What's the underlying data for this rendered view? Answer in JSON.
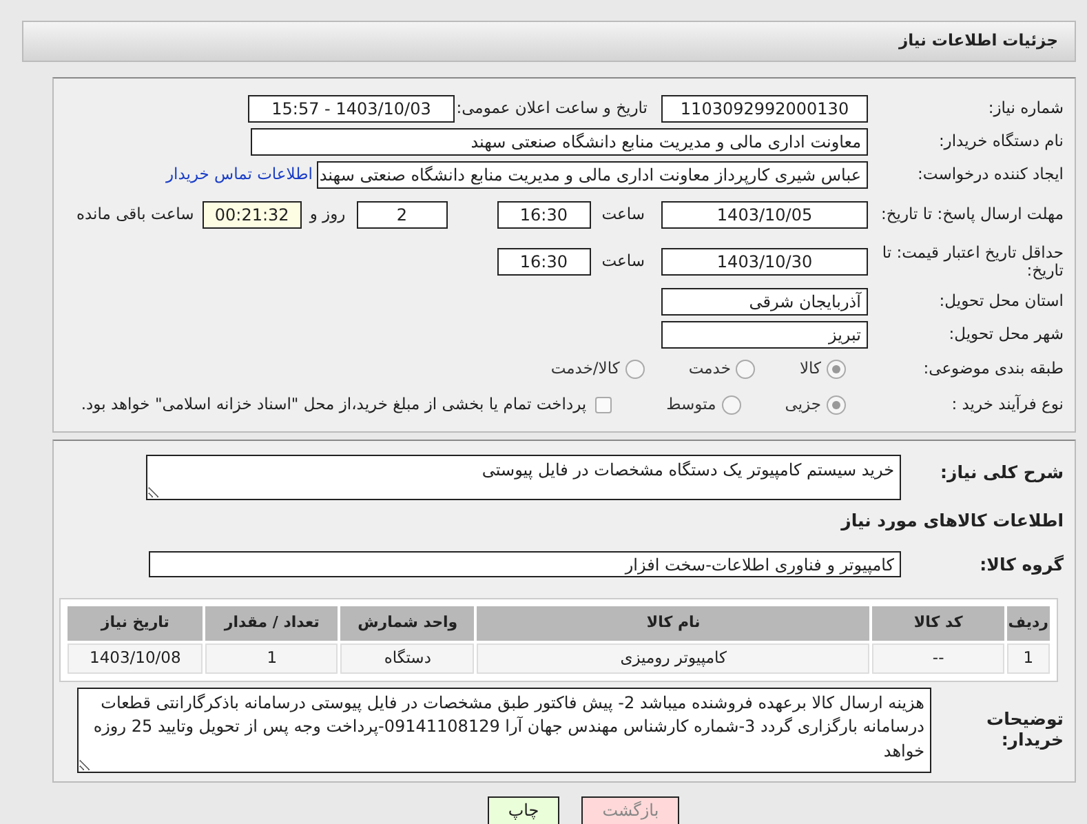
{
  "header": {
    "title": "جزئیات اطلاعات نیاز"
  },
  "need_number": {
    "label": "شماره نیاز:",
    "value": "1103092992000130"
  },
  "announce": {
    "label": "تاریخ و ساعت اعلان عمومی:",
    "value": "1403/10/03 - 15:57"
  },
  "buyer_org": {
    "label": "نام دستگاه خریدار:",
    "value": "معاونت اداری  مالی و مدیریت منابع دانشگاه صنعتی سهند"
  },
  "creator": {
    "label": "ایجاد کننده درخواست:",
    "value": "عباس شیری کارپرداز معاونت اداری  مالی و مدیریت منابع دانشگاه صنعتی سهند",
    "link": "اطلاعات تماس خریدار"
  },
  "reply_deadline": {
    "label": "مهلت ارسال پاسخ: تا تاریخ:",
    "date": "1403/10/05",
    "time_label": "ساعت",
    "time": "16:30",
    "days": "2",
    "days_label": "روز و",
    "remaining": "00:21:32",
    "remaining_label": "ساعت باقی مانده"
  },
  "price_validity": {
    "label": "حداقل تاریخ اعتبار قیمت: تا تاریخ:",
    "date": "1403/10/30",
    "time_label": "ساعت",
    "time": "16:30"
  },
  "province": {
    "label": "استان محل تحویل:",
    "value": "آذربایجان شرقی"
  },
  "city": {
    "label": "شهر محل تحویل:",
    "value": "تبریز"
  },
  "category": {
    "label": "طبقه بندی موضوعی:",
    "options": [
      {
        "label": "کالا",
        "selected": true
      },
      {
        "label": "خدمت",
        "selected": false
      },
      {
        "label": "کالا/خدمت",
        "selected": false
      }
    ]
  },
  "process": {
    "label": "نوع فرآیند خرید :",
    "options": [
      {
        "label": "جزیی",
        "selected": true
      },
      {
        "label": "متوسط",
        "selected": false
      }
    ],
    "treasury": {
      "checked": false,
      "label": "پرداخت تمام یا بخشی از مبلغ خرید،از محل \"اسناد خزانه اسلامی\" خواهد بود."
    }
  },
  "description": {
    "label": "شرح کلی نیاز:",
    "value": "خرید سیستم کامپیوتر یک دستگاه مشخصات در فایل پیوستی"
  },
  "goods_title": "اطلاعات کالاهای مورد نیاز",
  "goods_group": {
    "label": "گروه کالا:",
    "value": "کامپیوتر و فناوری اطلاعات-سخت افزار"
  },
  "table": {
    "columns": [
      "ردیف",
      "کد کالا",
      "نام کالا",
      "واحد شمارش",
      "تعداد / مقدار",
      "تاریخ نیاز"
    ],
    "rows": [
      [
        "1",
        "--",
        "کامپیوتر رومیزی",
        "دستگاه",
        "1",
        "1403/10/08"
      ]
    ]
  },
  "buyer_notes": {
    "label": "توضیحات خریدار:",
    "value": "هزینه ارسال کالا برعهده فروشنده میباشد 2- پیش فاکتور طبق مشخصات در فایل پیوستی درسامانه باذکرگارانتی قطعات درسامانه بارگزاری گردد 3-شماره کارشناس مهندس جهان آرا 09141108129-پرداخت وجه پس از تحویل وتایید 25 روزه خواهد"
  },
  "buttons": [
    {
      "label": "بازگشت",
      "kind": "back"
    },
    {
      "label": "چاپ",
      "kind": "print"
    }
  ]
}
